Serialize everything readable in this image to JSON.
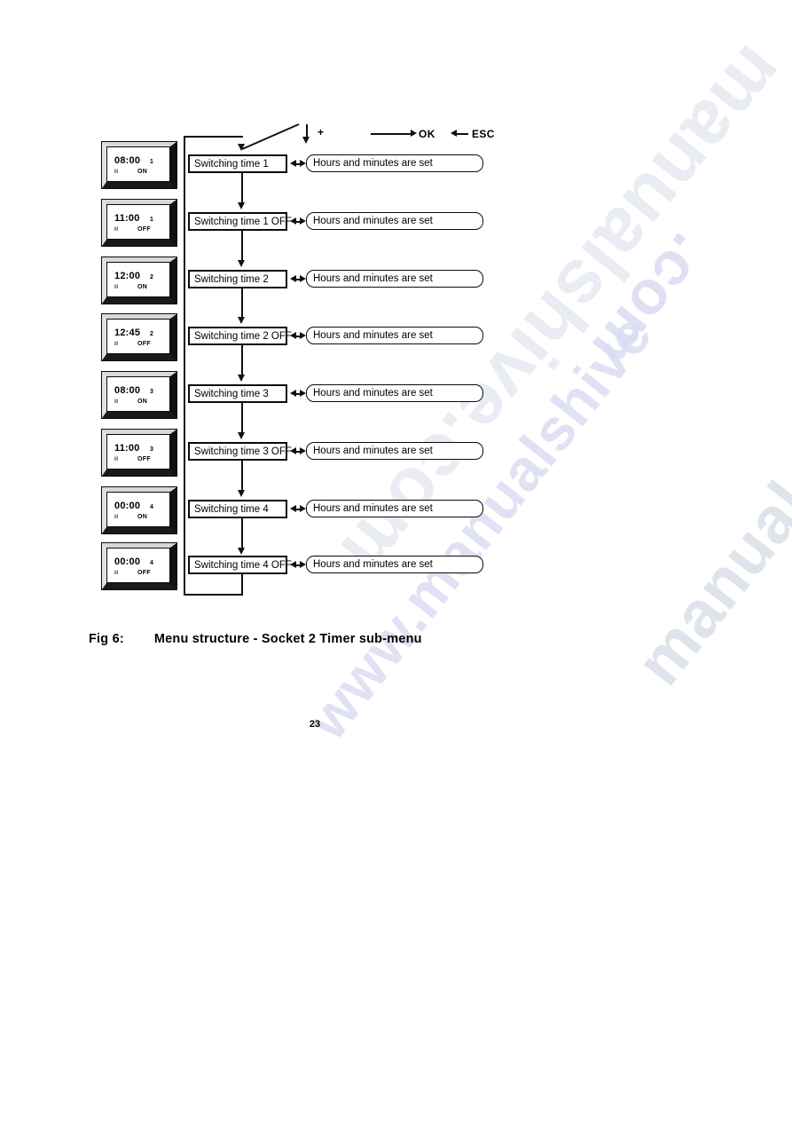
{
  "document": {
    "caption_label": "Fig 6:",
    "caption_text": "Menu structure - Socket 2 Timer sub-menu",
    "page_number": "23"
  },
  "legend": {
    "down_arrow_symbol": "down-arrow-icon",
    "plus_label": "+",
    "ok_label": "OK",
    "esc_label": "ESC"
  },
  "displays": [
    {
      "time": "08:00",
      "index": "1",
      "socket": "II",
      "state": "ON"
    },
    {
      "time": "11:00",
      "index": "1",
      "socket": "II",
      "state": "OFF"
    },
    {
      "time": "12:00",
      "index": "2",
      "socket": "II",
      "state": "ON"
    },
    {
      "time": "12:45",
      "index": "2",
      "socket": "II",
      "state": "OFF"
    },
    {
      "time": "08:00",
      "index": "3",
      "socket": "II",
      "state": "ON"
    },
    {
      "time": "11:00",
      "index": "3",
      "socket": "II",
      "state": "OFF"
    },
    {
      "time": "00:00",
      "index": "4",
      "socket": "II",
      "state": "ON"
    },
    {
      "time": "00:00",
      "index": "4",
      "socket": "II",
      "state": "OFF"
    }
  ],
  "rows": [
    {
      "menu": "Switching time 1",
      "action": "Hours and minutes are set"
    },
    {
      "menu": "Switching time 1 OFF",
      "action": "Hours and minutes are set"
    },
    {
      "menu": "Switching time 2",
      "action": "Hours and minutes are set"
    },
    {
      "menu": "Switching time 2 OFF",
      "action": "Hours and minutes are set"
    },
    {
      "menu": "Switching time 3",
      "action": "Hours and minutes are set"
    },
    {
      "menu": "Switching time 3 OFF",
      "action": "Hours and minutes are set"
    },
    {
      "menu": "Switching time 4",
      "action": "Hours and minutes are set"
    },
    {
      "menu": "Switching time 4 OFF",
      "action": "Hours and minutes are set"
    }
  ],
  "watermark": {
    "text_a": "manualshive.com",
    "text_b": "manualshive.com",
    "text_c": ".com",
    "text_d": "www.manualshive"
  }
}
